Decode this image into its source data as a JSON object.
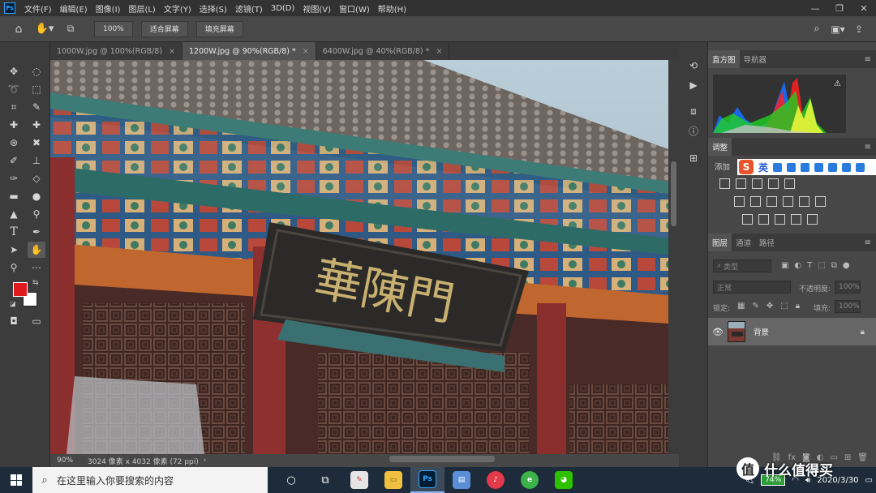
{
  "menubar": {
    "logo": "Ps",
    "items": [
      "文件(F)",
      "编辑(E)",
      "图像(I)",
      "图层(L)",
      "文字(Y)",
      "选择(S)",
      "滤镜(T)",
      "3D(D)",
      "视图(V)",
      "窗口(W)",
      "帮助(H)"
    ]
  },
  "options": {
    "zoom_value": "100%",
    "fit_screen": "适合屏幕",
    "fill_screen": "填充屏幕"
  },
  "tabs": [
    {
      "label": "1000W.jpg @ 100%(RGB/8)"
    },
    {
      "label": "1200W.jpg @ 90%(RGB/8) *"
    },
    {
      "label": "6400W.jpg @ 40%(RGB/8) *"
    }
  ],
  "canvas": {
    "sign_text": "華陳門"
  },
  "status": {
    "zoom": "90%",
    "info": "3024 像素 x 4032 像素 (72 ppi)"
  },
  "panels": {
    "histogram_tab": "直方图",
    "navigator_tab": "导航器",
    "adjust_tab": "调整",
    "adjust_add": "添加",
    "ime_label": "英",
    "layers_tab": "图层",
    "channels_tab": "通道",
    "paths_tab": "路径",
    "kind_placeholder": "类型",
    "blend_mode": "正常",
    "opacity_label": "不透明度:",
    "opacity_value": "100%",
    "lock_label": "锁定:",
    "fill_label": "填充:",
    "fill_value": "100%",
    "layer_name": "背景"
  },
  "taskbar": {
    "search_placeholder": "在这里输入你要搜索的内容",
    "ps_label": "Ps",
    "battery": "74%",
    "date": "2020/3/30"
  },
  "watermark": {
    "logo": "值",
    "text": "什么值得买"
  },
  "colors": {
    "foreground": "#e0191f",
    "background": "#ffffff",
    "accent": "#31a8ff"
  }
}
